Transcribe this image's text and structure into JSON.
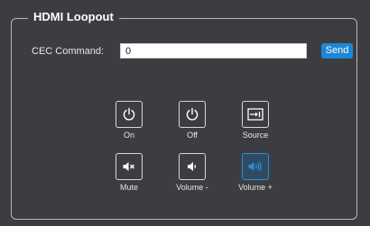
{
  "panel": {
    "title": "HDMI Loopout"
  },
  "cec": {
    "label": "CEC Command:",
    "value": "0",
    "send_label": "Send"
  },
  "controls": [
    {
      "label": "On",
      "icon": "power-icon",
      "active": false
    },
    {
      "label": "Off",
      "icon": "power-icon",
      "active": false
    },
    {
      "label": "Source",
      "icon": "source-input-icon",
      "active": false
    },
    {
      "label": "Mute",
      "icon": "speaker-mute-icon",
      "active": false
    },
    {
      "label": "Volume -",
      "icon": "volume-down-icon",
      "active": false
    },
    {
      "label": "Volume +",
      "icon": "volume-up-icon",
      "active": true
    }
  ],
  "colors": {
    "background": "#3d3d41",
    "accent": "#1c87d6",
    "icon": "#ffffff",
    "active_icon": "#2a8fe0"
  }
}
